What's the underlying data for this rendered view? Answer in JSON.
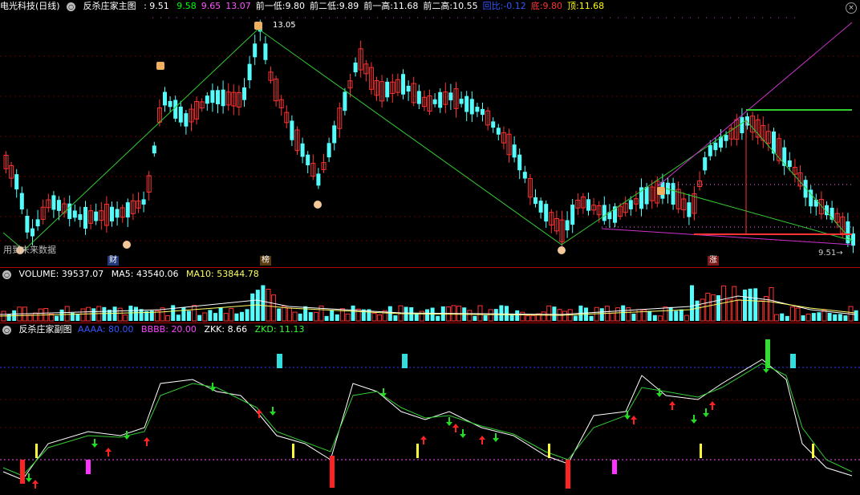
{
  "main": {
    "stock_name": "电光科技(日线)",
    "indicator": "反杀庄家主图",
    "last": "9.51",
    "values": [
      {
        "label": "",
        "value": "9.58",
        "color": "#00ff00"
      },
      {
        "label": "",
        "value": "9.65",
        "color": "#ff55ff"
      },
      {
        "label": "",
        "value": "13.07",
        "color": "#ff55ff"
      },
      {
        "label": "前一低:",
        "value": "9.80",
        "color": "#ffffff"
      },
      {
        "label": "前二低:",
        "value": "9.89",
        "color": "#ffffff"
      },
      {
        "label": "前一高:",
        "value": "11.68",
        "color": "#ffffff"
      },
      {
        "label": "前二高:",
        "value": "10.55",
        "color": "#ffffff"
      },
      {
        "label": "回比:",
        "value": "-0.12",
        "color": "#3355ff"
      },
      {
        "label": "底:",
        "value": "9.80",
        "color": "#ff3333"
      },
      {
        "label": "顶:",
        "value": "11.68",
        "color": "#ffff00"
      }
    ],
    "peak_label": "13.05",
    "last_price_label": "9.51",
    "future_text": "用到未来数据",
    "markers": [
      "财",
      "榜",
      "涨"
    ]
  },
  "volume": {
    "label": "VOLUME:",
    "value": "39537.07",
    "ma5_label": "MA5:",
    "ma5": "43540.06",
    "ma10_label": "MA10:",
    "ma10": "53844.78"
  },
  "sub": {
    "indicator": "反杀庄家副图",
    "aaaa_label": "AAAA:",
    "aaaa": "80.00",
    "bbbb_label": "BBBB:",
    "bbbb": "20.00",
    "zkk_label": "ZKK:",
    "zkk": "8.66",
    "zkd_label": "ZKD:",
    "zkd": "11.13"
  },
  "colors": {
    "up": "#ff3333",
    "down": "#54fcfc",
    "zigzag": "#33cc33",
    "purple": "#cc33cc",
    "separator": "#b00000"
  },
  "icons": [
    "circle-icon",
    "close-icon"
  ]
}
